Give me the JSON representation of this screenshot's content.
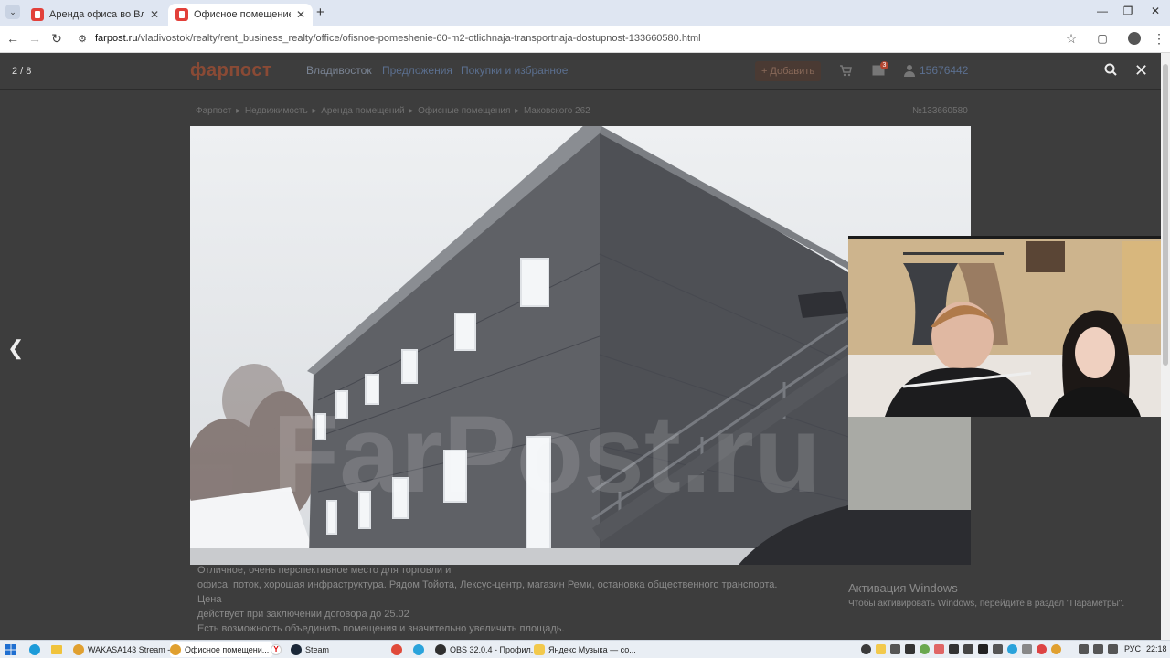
{
  "browser": {
    "tabs": [
      {
        "title": "Аренда офиса во Владивосто"
      },
      {
        "title": "Офисное помещение 60 м2 -"
      }
    ],
    "url_domain": "farpost.ru",
    "url_path": "/vladivostok/realty/rent_business_realty/office/ofisnoe-pomeshenie-60-m2-otlichnaja-transportnaja-dostupnost-133660580.html"
  },
  "site": {
    "logo": "фарпост",
    "city": "Владивосток",
    "nav": [
      "Предложения",
      "Покупки и избранное"
    ],
    "add_label": "+ Добавить",
    "messages_badge": "3",
    "user_id": "15676442"
  },
  "viewer": {
    "counter": "2 / 8"
  },
  "breadcrumbs": [
    "Фарпост",
    "Недвижимость",
    "Аренда помещений",
    "Офисные помещения",
    "Маковского 262"
  ],
  "ad_number": "№133660580",
  "watermark": "FarPost.ru",
  "description": [
    "Отличное, очень перспективное место для торговли и",
    "офиса, поток, хорошая инфраструктура. Рядом Тойота, Лексус-центр, магазин Реми, остановка общественного транспорта. Цена",
    "действует при заключении договора до 25.02",
    "Есть возможность объединить помещения и значительно увеличить площадь."
  ],
  "windows_activation": {
    "title": "Активация Windows",
    "subtitle": "Чтобы активировать Windows, перейдите в раздел \"Параметры\"."
  },
  "taskbar": {
    "apps": [
      {
        "label": "WAKASA143 Stream -..."
      },
      {
        "label": "Офисное помещени..."
      },
      {
        "label": "Steam"
      },
      {
        "label": "OBS 32.0.4 - Профил..."
      },
      {
        "label": "Яндекс Музыка — со..."
      }
    ],
    "lang": "РУС",
    "time": "22:18"
  }
}
